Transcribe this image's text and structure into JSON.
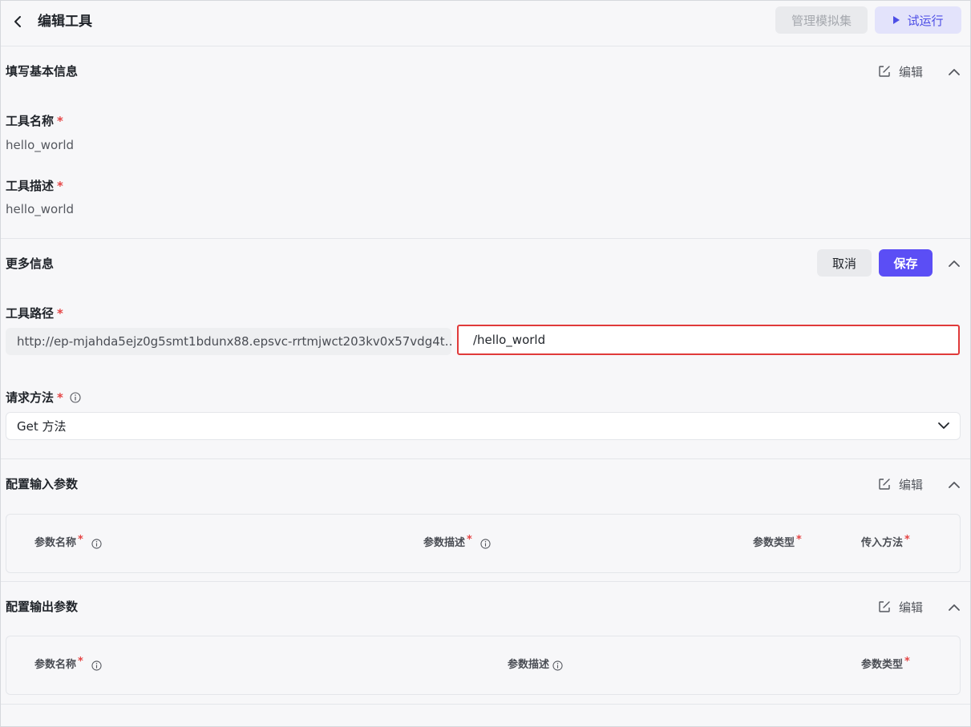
{
  "header": {
    "title": "编辑工具",
    "manage_mock_label": "管理模拟集",
    "trial_run_label": "试运行"
  },
  "basic_info": {
    "title": "填写基本信息",
    "edit_label": "编辑",
    "tool_name_label": "工具名称",
    "tool_name_value": "hello_world",
    "tool_desc_label": "工具描述",
    "tool_desc_value": "hello_world",
    "required_mark": "*"
  },
  "more_info": {
    "title": "更多信息",
    "cancel_label": "取消",
    "save_label": "保存",
    "tool_path_label": "工具路径",
    "url_prefix": "http://ep-mjahda5ejz0g5smt1bdunx88.epsvc-rrtmjwct203kv0x57vdg4t…",
    "path_value": "/hello_world",
    "method_label": "请求方法",
    "method_value": "Get 方法",
    "required_mark": "*"
  },
  "input_params": {
    "title": "配置输入参数",
    "edit_label": "编辑",
    "columns": [
      {
        "label": "参数名称",
        "required": "*"
      },
      {
        "label": "参数描述",
        "required": "*"
      },
      {
        "label": "参数类型",
        "required": "*"
      },
      {
        "label": "传入方法",
        "required": "*"
      }
    ]
  },
  "output_params": {
    "title": "配置输出参数",
    "edit_label": "编辑",
    "columns": [
      {
        "label": "参数名称",
        "required": "*"
      },
      {
        "label": "参数描述",
        "required": ""
      },
      {
        "label": "参数类型",
        "required": "*"
      }
    ]
  },
  "colors": {
    "primary": "#5b4ef5",
    "required": "#e54545",
    "focus_border": "#e03a3a"
  }
}
